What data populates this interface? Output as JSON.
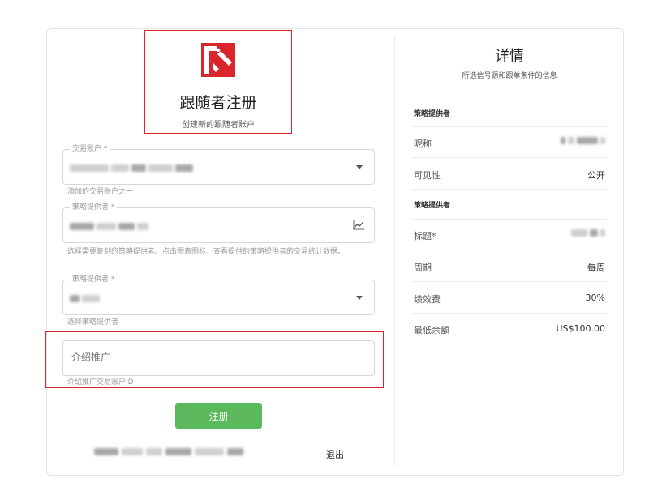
{
  "form": {
    "title": "跟随者注册",
    "subtitle": "创建新的跟随者账户",
    "trading_account": {
      "label": "交易账户 *",
      "hint": "添加的交易账户之一"
    },
    "strategy_provider_1": {
      "label": "策略提供者 *",
      "hint": "选择需要复制的策略提供者。点击图表图标，查看提供的策略提供者的交易统计数据。"
    },
    "strategy_provider_2": {
      "label": "策略提供者 *",
      "hint": "选择策略提供者"
    },
    "referral": {
      "placeholder": "介绍推广",
      "hint": "介绍推广交易账户ID"
    },
    "register_label": "注册",
    "logout_label": "退出"
  },
  "details": {
    "title": "详情",
    "subtitle": "所选信号源和跟单条件的信息",
    "section1_label": "策略提供者",
    "section2_label": "策略提供者",
    "rows1": [
      {
        "label": "昵称"
      },
      {
        "label": "可见性",
        "value": "公开"
      }
    ],
    "rows2": [
      {
        "label": "标题*"
      },
      {
        "label": "周期",
        "value": "每周"
      },
      {
        "label": "绩效费",
        "value": "30%"
      },
      {
        "label": "最低余额",
        "value": "US$100.00"
      }
    ]
  },
  "icons": {
    "logo": "brand-logo-icon",
    "caret": "chevron-down-icon",
    "chart": "chart-icon"
  },
  "colors": {
    "accent_red": "#d9252b",
    "button_green": "#5cb85c"
  }
}
